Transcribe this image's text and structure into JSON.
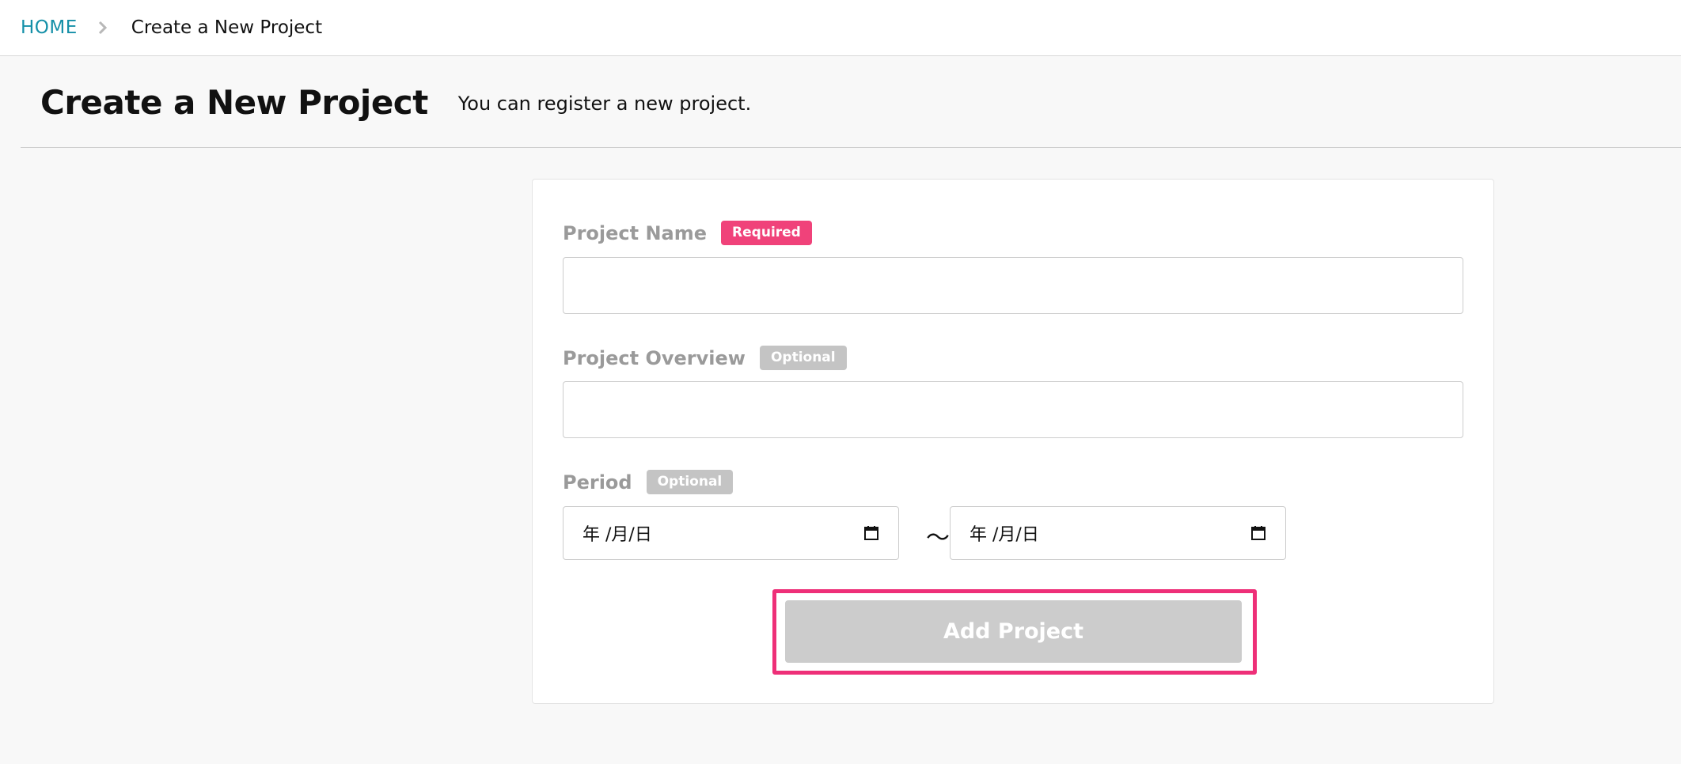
{
  "breadcrumb": {
    "home": "HOME",
    "current": "Create a New Project"
  },
  "header": {
    "title": "Create a New Project",
    "description": "You can register a new project."
  },
  "form": {
    "project_name": {
      "label": "Project Name",
      "badge": "Required",
      "value": ""
    },
    "project_overview": {
      "label": "Project Overview",
      "badge": "Optional",
      "value": ""
    },
    "period": {
      "label": "Period",
      "badge": "Optional",
      "start_placeholder": "年 /月/日",
      "separator": "〜",
      "end_placeholder": "年 /月/日"
    },
    "submit_label": "Add Project"
  },
  "colors": {
    "link": "#1590a8",
    "required_badge": "#f0427a",
    "optional_badge": "#c4c4c4",
    "disabled_button": "#cccccc",
    "highlight": "#ee2f78"
  },
  "icons": {
    "breadcrumb_separator": "chevron-right-icon",
    "date_picker": "calendar-icon"
  }
}
